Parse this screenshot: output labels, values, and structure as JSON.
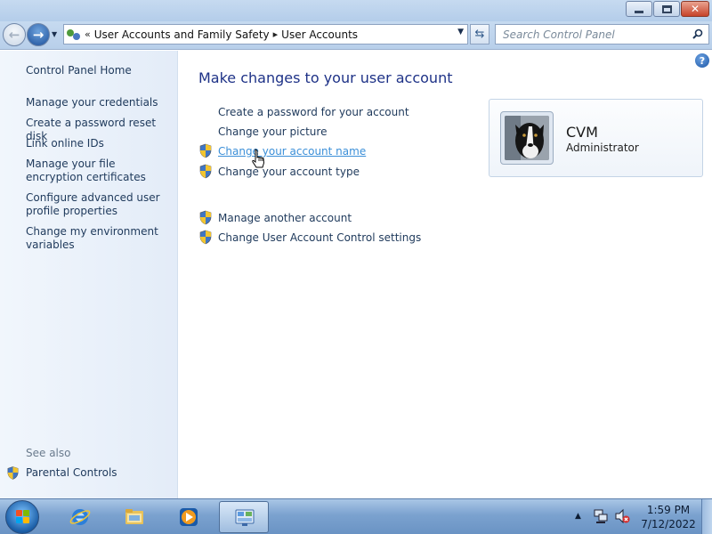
{
  "window": {
    "minimize_icon": "minimize-icon",
    "maximize_icon": "maximize-icon",
    "close_icon": "close-icon"
  },
  "navigation": {
    "back_icon": "back-arrow-icon",
    "forward_icon": "forward-arrow-icon",
    "breadcrumb": [
      {
        "label": "User Accounts and Family Safety"
      },
      {
        "label": "User Accounts"
      }
    ],
    "search_placeholder": "Search Control Panel",
    "refresh_icon": "refresh-icon"
  },
  "sidebar": {
    "home": "Control Panel Home",
    "links": [
      "Manage your credentials",
      "Create a password reset disk",
      "Link online IDs",
      "Manage your file encryption certificates",
      "Configure advanced user profile properties",
      "Change my environment variables"
    ],
    "see_also_label": "See also",
    "see_also_links": [
      "Parental Controls"
    ]
  },
  "main": {
    "title": "Make changes to your user account",
    "tasks": [
      {
        "label": "Create a password for your account",
        "shield": false
      },
      {
        "label": "Change your picture",
        "shield": false
      },
      {
        "label": "Change your account name",
        "shield": true,
        "hovered": true
      },
      {
        "label": "Change your account type",
        "shield": true
      }
    ],
    "tasks2": [
      {
        "label": "Manage another account",
        "shield": true
      },
      {
        "label": "Change User Account Control settings",
        "shield": true
      }
    ],
    "account": {
      "name": "CVM",
      "role": "Administrator"
    }
  },
  "taskbar": {
    "items": [
      "start-button",
      "internet-explorer",
      "windows-explorer",
      "windows-media-player",
      "control-panel"
    ],
    "active_item": "control-panel",
    "clock_time": "1:59 PM",
    "clock_date": "7/12/2022"
  },
  "colors": {
    "link": "#1e395b",
    "title": "#1e3287",
    "hover_link": "#3b8fd8"
  }
}
